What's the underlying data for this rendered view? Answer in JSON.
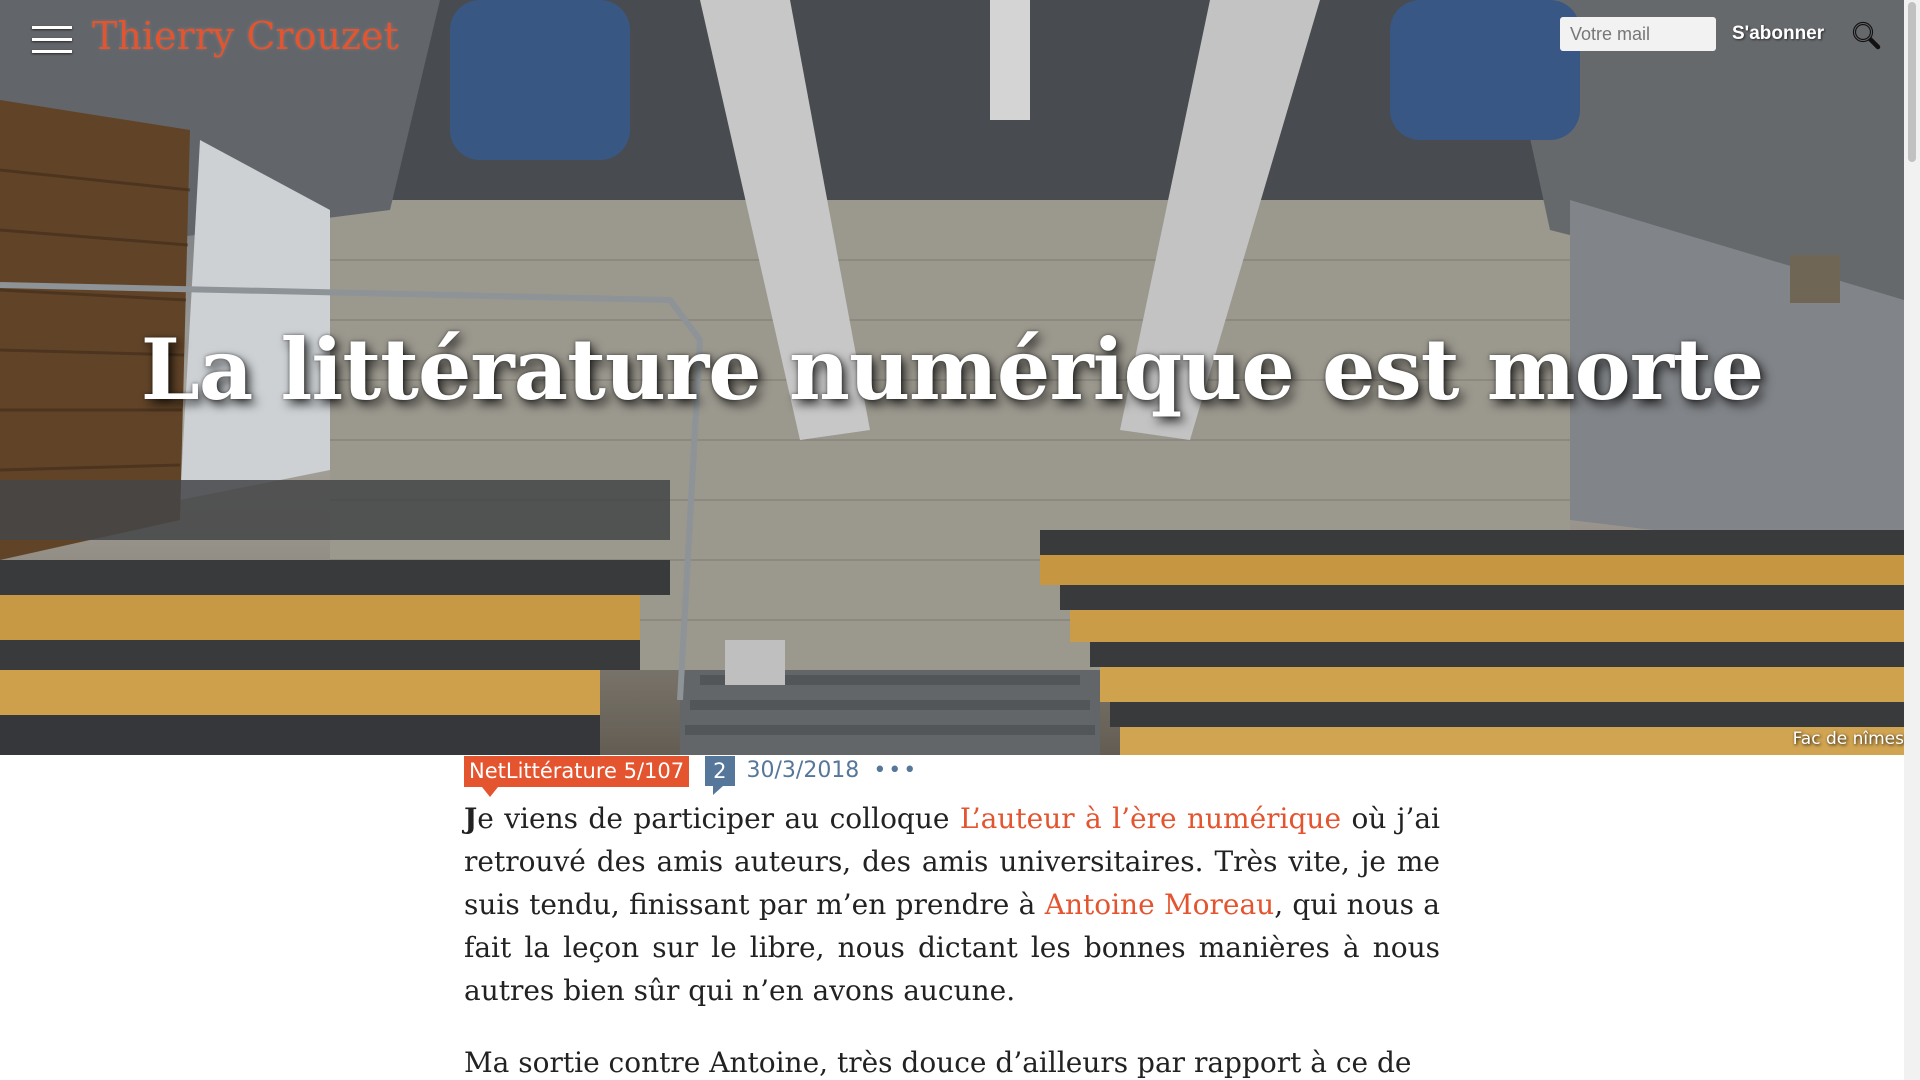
{
  "header": {
    "site_title": "Thierry Crouzet",
    "email_placeholder": "Votre mail",
    "subscribe_label": "S'abonner"
  },
  "hero": {
    "title": "La littérature numérique est morte",
    "caption": "Fac de nîmes"
  },
  "meta": {
    "category": "NetLittérature 5/107",
    "comments": "2",
    "date": "30/3/2018",
    "more": "•••"
  },
  "article": {
    "p1": {
      "dropcap": "J",
      "t1": "e viens de participer au colloque ",
      "link1": "L’auteur à l’ère numérique",
      "t2": " où j’ai retrouvé des amis auteurs, des amis universitaires. Très vite, je me suis tendu, finissant par m’en prendre à ",
      "link2": "Antoine Moreau",
      "t3": ", qui nous a fait la leçon sur le libre, nous dictant les bonnes manières à nous autres bien sûr qui n’en avons aucune."
    },
    "p2": "Ma sortie contre Antoine, très douce d’ailleurs par rapport à ce de"
  },
  "colors": {
    "accent": "#e4542f",
    "meta_blue": "#56779a",
    "text": "#222222"
  },
  "icons": {
    "menu": "hamburger-menu-icon",
    "search": "search-icon"
  }
}
